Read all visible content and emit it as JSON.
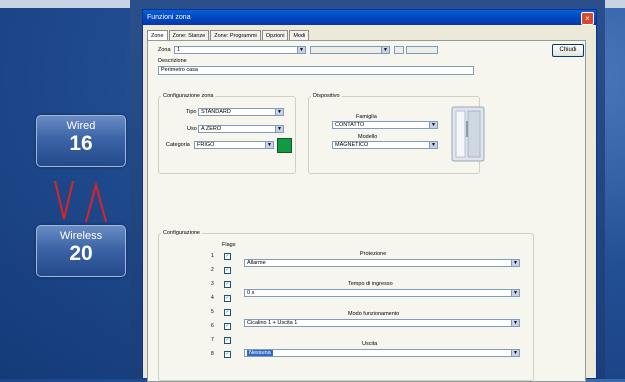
{
  "window": {
    "title": "Funzioni zona"
  },
  "tabs": [
    "Zone",
    "Zone: Stanze",
    "Zone: Programmi",
    "Opzioni",
    "Modi"
  ],
  "top": {
    "zone_label": "Zona",
    "zone_value": "1",
    "close_label": "Chiudi"
  },
  "description": {
    "label": "Descrizione",
    "value": "Perimetro casa"
  },
  "zone_config": {
    "title": "Configurazione zona",
    "type_label": "Tipo",
    "type_value": "STANDARD",
    "use_label": "Uso",
    "use_value": "A ZERO",
    "category_label": "Categoria",
    "category_value": "FRIGO"
  },
  "device": {
    "title": "Dispositivo",
    "family_label": "Famiglia",
    "family_value": "CONTATTO",
    "model_label": "Modello",
    "model_value": "MAGNETICO"
  },
  "config": {
    "title": "Configurazione",
    "flags_header": "Flags",
    "rows": [
      {
        "num": "1",
        "checked": true
      },
      {
        "num": "2",
        "checked": true
      },
      {
        "num": "3",
        "checked": true
      },
      {
        "num": "4",
        "checked": true
      },
      {
        "num": "5",
        "checked": true
      },
      {
        "num": "6",
        "checked": true
      },
      {
        "num": "7",
        "checked": true
      },
      {
        "num": "8",
        "checked": true
      }
    ],
    "fields": [
      {
        "label": "Protezione",
        "value": "Allarme"
      },
      {
        "label": "Tempo di ingresso",
        "value": "0 s"
      },
      {
        "label": "Modo funzionamento",
        "value": "Cicalino 1 + Uscita 1"
      },
      {
        "label": "Uscita",
        "value": "Nessuna"
      }
    ]
  },
  "badges": {
    "wired": {
      "label": "Wired",
      "count": "16"
    },
    "wireless": {
      "label": "Wireless",
      "count": "20"
    }
  },
  "colors": {
    "arrow": "#e02222",
    "accent": "#0a5fd8",
    "badge": "#3c64a6"
  }
}
